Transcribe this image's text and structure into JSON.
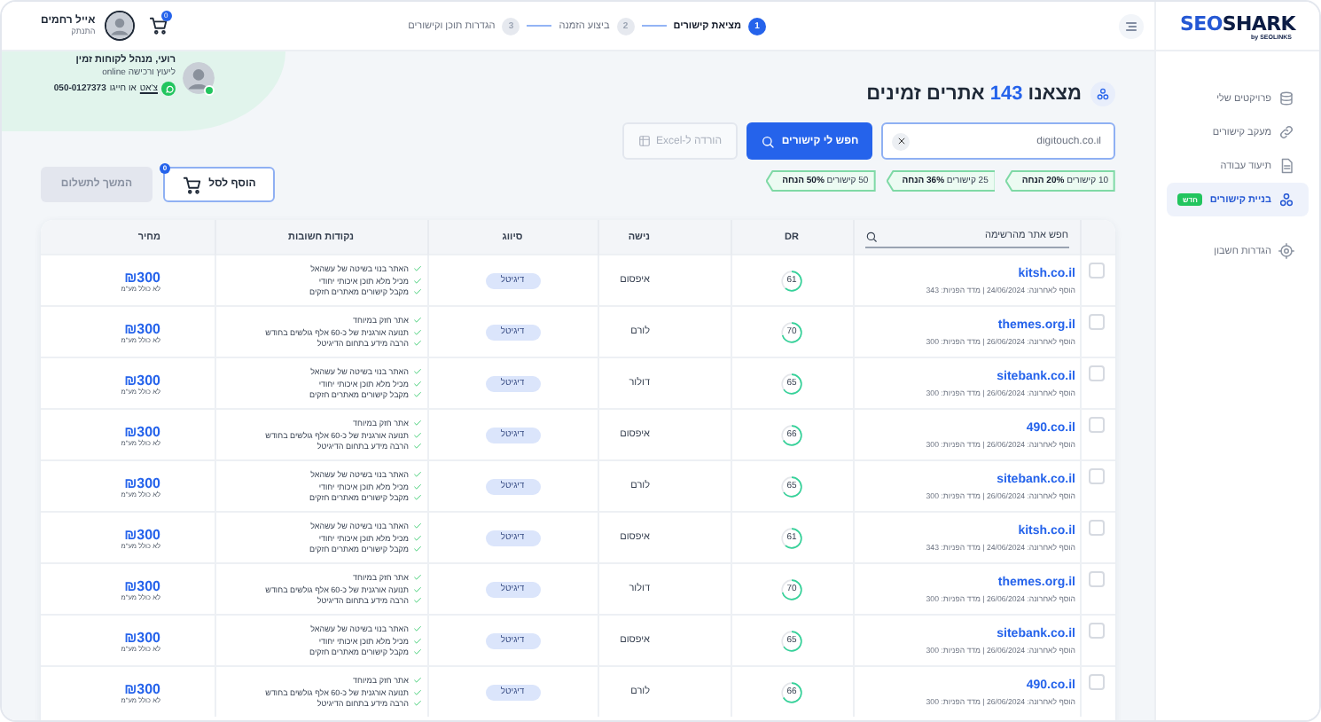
{
  "topbar": {
    "logo": {
      "part_1": "SEO",
      "part_2": "SHARK",
      "tagline": "by SEOLINKS"
    },
    "steps": [
      {
        "number": "1",
        "label": "מציאת קישורים",
        "selected": true
      },
      {
        "number": "2",
        "label": "ביצוע הזמנה",
        "selected": false
      },
      {
        "number": "3",
        "label": "הגדרות תוכן וקישורים",
        "selected": false
      }
    ],
    "cart": {
      "count": "0"
    },
    "user": {
      "name": "אייל רחמים",
      "action": "התנתק"
    }
  },
  "sidebar": {
    "items": [
      {
        "kind": "projects",
        "label": "פרויקטים שלי",
        "selected": false
      },
      {
        "kind": "links",
        "label": "מעקב קישורים",
        "selected": false
      },
      {
        "kind": "docs",
        "label": "תיעוד עבודה",
        "selected": false
      },
      {
        "kind": "build",
        "label": "בניית קישורים",
        "badge": "חדש",
        "selected": true
      }
    ],
    "footer_items": [
      {
        "kind": "settings",
        "label": "הגדרות חשבון",
        "selected": false
      }
    ]
  },
  "agent": {
    "name": "רועי, מנהל לקוחות זמין",
    "subtitle": "ליעוץ ורכישה online",
    "online": true,
    "chat_link": "צ'אט",
    "call_text": "או חייגו",
    "phone": "050-0127373"
  },
  "header": {
    "title": {
      "prefix": "מצאנו",
      "count": "143",
      "suffix": "אתרים זמינים"
    },
    "search": {
      "value": "digitouch.co.il"
    },
    "search_button": "חפש לי קישורים",
    "export_button": {
      "label": "הורדה ל-Excel",
      "disabled": true
    },
    "offers": [
      "10 קישורים **20% הנחה**",
      "25 קישורים **36% הנחה**",
      "50 קישורים **50% הנחה**"
    ],
    "cart_button": {
      "label": "הוסף לסל",
      "count": "0"
    },
    "checkout_button": {
      "label": "המשך לתשלום",
      "disabled": true
    }
  },
  "table": {
    "search_placeholder": "חפש אתר מהרשימה",
    "columns": [
      "DR",
      "נישה",
      "סיווג",
      "נקודות חשובות",
      "מחיר"
    ],
    "rows": [
      {
        "checked": false,
        "site": "kitsh.co.il",
        "meta": "הוסף לאחרונה: 24/06/2024 | מדד הפניות: 343",
        "dr": "61",
        "niche": "איפסום",
        "category": "דיגיטל",
        "points": [
          "האתר בנוי בשיטה של עשהאל",
          "מכיל מלא תוכן איכותי יחודי",
          "מקבל קישורים מאתרים חזקים"
        ],
        "price": "₪300",
        "price_note": "לא כולל מע\"מ"
      },
      {
        "checked": false,
        "site": "themes.org.il",
        "meta": "הוסף לאחרונה: 26/06/2024 | מדד הפניות: 300",
        "dr": "70",
        "niche": "לורם",
        "category": "דיגיטל",
        "points": [
          "אתר חזק במיוחד",
          "תנועה אורגנית של כ-60 אלף גולשים בחודש",
          "הרבה מידע בתחום הדיגיטל"
        ],
        "price": "₪300",
        "price_note": "לא כולל מע\"מ"
      },
      {
        "checked": false,
        "site": "sitebank.co.il",
        "meta": "הוסף לאחרונה: 26/06/2024 | מדד הפניות: 300",
        "dr": "65",
        "niche": "דולור",
        "category": "דיגיטל",
        "points": [
          "האתר בנוי בשיטה של עשהאל",
          "מכיל מלא תוכן איכותי יחודי",
          "מקבל קישורים מאתרים חזקים"
        ],
        "price": "₪300",
        "price_note": "לא כולל מע\"מ"
      },
      {
        "checked": false,
        "site": "490.co.il",
        "meta": "הוסף לאחרונה: 26/06/2024 | מדד הפניות: 300",
        "dr": "66",
        "niche": "איפסום",
        "category": "דיגיטל",
        "points": [
          "אתר חזק במיוחד",
          "תנועה אורגנית של כ-60 אלף גולשים בחודש",
          "הרבה מידע בתחום הדיגיטל"
        ],
        "price": "₪300",
        "price_note": "לא כולל מע\"מ"
      },
      {
        "checked": false,
        "site": "sitebank.co.il",
        "meta": "הוסף לאחרונה: 26/06/2024 | מדד הפניות: 300",
        "dr": "65",
        "niche": "לורם",
        "category": "דיגיטל",
        "points": [
          "האתר בנוי בשיטה של עשהאל",
          "מכיל מלא תוכן איכותי יחודי",
          "מקבל קישורים מאתרים חזקים"
        ],
        "price": "₪300",
        "price_note": "לא כולל מע\"מ"
      },
      {
        "checked": false,
        "site": "kitsh.co.il",
        "meta": "הוסף לאחרונה: 24/06/2024 | מדד הפניות: 343",
        "dr": "61",
        "niche": "איפסום",
        "category": "דיגיטל",
        "points": [
          "האתר בנוי בשיטה של עשהאל",
          "מכיל מלא תוכן איכותי יחודי",
          "מקבל קישורים מאתרים חזקים"
        ],
        "price": "₪300",
        "price_note": "לא כולל מע\"מ"
      },
      {
        "checked": false,
        "site": "themes.org.il",
        "meta": "הוסף לאחרונה: 26/06/2024 | מדד הפניות: 300",
        "dr": "70",
        "niche": "דולור",
        "category": "דיגיטל",
        "points": [
          "אתר חזק במיוחד",
          "תנועה אורגנית של כ-60 אלף גולשים בחודש",
          "הרבה מידע בתחום הדיגיטל"
        ],
        "price": "₪300",
        "price_note": "לא כולל מע\"מ"
      },
      {
        "checked": false,
        "site": "sitebank.co.il",
        "meta": "הוסף לאחרונה: 26/06/2024 | מדד הפניות: 300",
        "dr": "65",
        "niche": "איפסום",
        "category": "דיגיטל",
        "points": [
          "האתר בנוי בשיטה של עשהאל",
          "מכיל מלא תוכן איכותי יחודי",
          "מקבל קישורים מאתרים חזקים"
        ],
        "price": "₪300",
        "price_note": "לא כולל מע\"מ"
      },
      {
        "checked": false,
        "site": "490.co.il",
        "meta": "הוסף לאחרונה: 26/06/2024 | מדד הפניות: 300",
        "dr": "66",
        "niche": "לורם",
        "category": "דיגיטל",
        "points": [
          "אתר חזק במיוחד",
          "תנועה אורגנית של כ-60 אלף גולשים בחודש",
          "הרבה מידע בתחום הדיגיטל"
        ],
        "price": "₪300",
        "price_note": "לא כולל מע\"מ"
      }
    ]
  }
}
